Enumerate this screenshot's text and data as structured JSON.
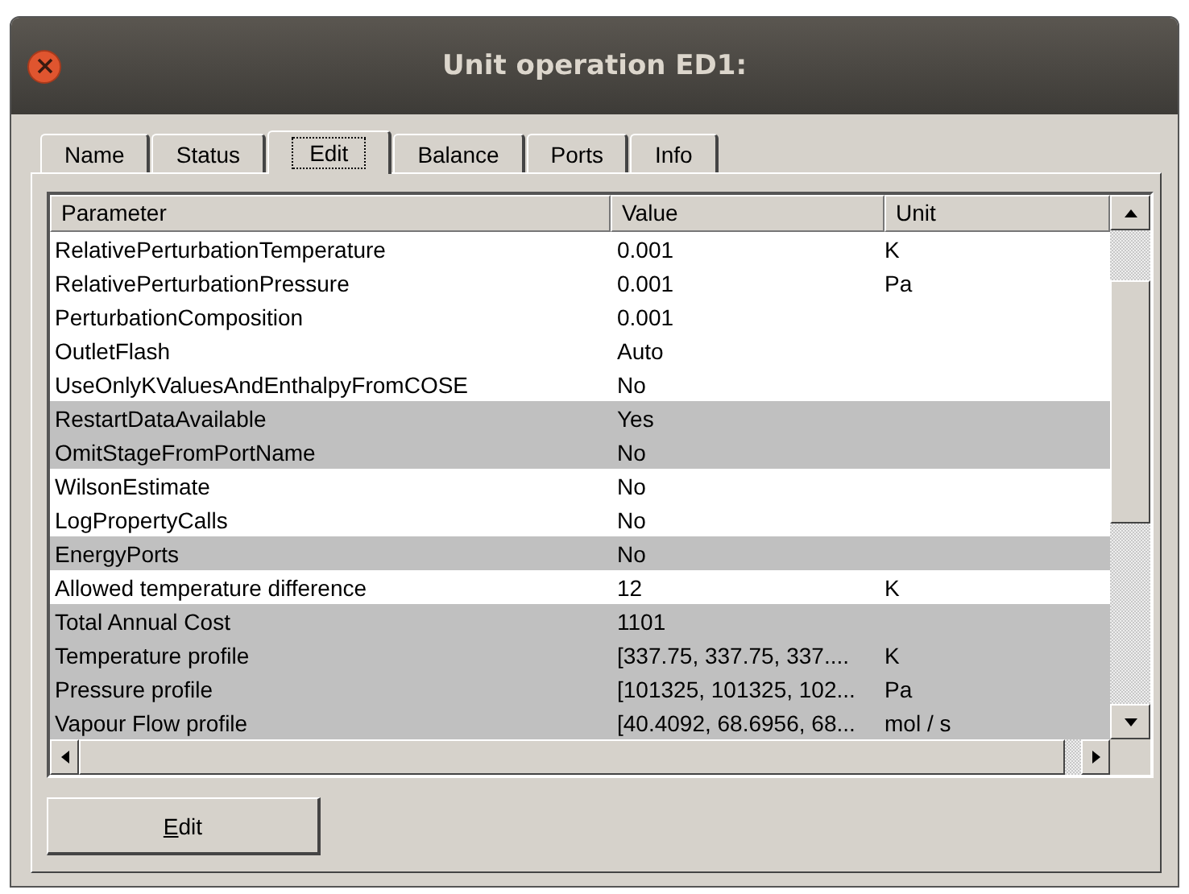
{
  "window": {
    "title": "Unit operation ED1:"
  },
  "tabs": [
    {
      "label": "Name",
      "selected": false
    },
    {
      "label": "Status",
      "selected": false
    },
    {
      "label": "Edit",
      "selected": true
    },
    {
      "label": "Balance",
      "selected": false
    },
    {
      "label": "Ports",
      "selected": false
    },
    {
      "label": "Info",
      "selected": false
    }
  ],
  "table": {
    "columns": [
      "Parameter",
      "Value",
      "Unit"
    ],
    "rows": [
      {
        "parameter": "RelativePerturbationTemperature",
        "value": "0.001",
        "unit": "K",
        "readonly": false
      },
      {
        "parameter": "RelativePerturbationPressure",
        "value": "0.001",
        "unit": "Pa",
        "readonly": false
      },
      {
        "parameter": "PerturbationComposition",
        "value": "0.001",
        "unit": "",
        "readonly": false
      },
      {
        "parameter": "OutletFlash",
        "value": "Auto",
        "unit": "",
        "readonly": false
      },
      {
        "parameter": "UseOnlyKValuesAndEnthalpyFromCOSE",
        "value": "No",
        "unit": "",
        "readonly": false
      },
      {
        "parameter": "RestartDataAvailable",
        "value": "Yes",
        "unit": "",
        "readonly": true
      },
      {
        "parameter": "OmitStageFromPortName",
        "value": "No",
        "unit": "",
        "readonly": true
      },
      {
        "parameter": "WilsonEstimate",
        "value": "No",
        "unit": "",
        "readonly": false
      },
      {
        "parameter": "LogPropertyCalls",
        "value": "No",
        "unit": "",
        "readonly": false
      },
      {
        "parameter": "EnergyPorts",
        "value": "No",
        "unit": "",
        "readonly": true
      },
      {
        "parameter": "Allowed temperature difference",
        "value": "12",
        "unit": "K",
        "readonly": false
      },
      {
        "parameter": "Total Annual Cost",
        "value": "1101",
        "unit": "",
        "readonly": true
      },
      {
        "parameter": "Temperature profile",
        "value": "[337.75, 337.75, 337....",
        "unit": "K",
        "readonly": true
      },
      {
        "parameter": "Pressure profile",
        "value": "[101325, 101325, 102...",
        "unit": "Pa",
        "readonly": true
      },
      {
        "parameter": "Vapour Flow profile",
        "value": "[40.4092, 68.6956, 68...",
        "unit": "mol / s",
        "readonly": true
      }
    ]
  },
  "buttons": [
    {
      "label": "Edit"
    }
  ]
}
